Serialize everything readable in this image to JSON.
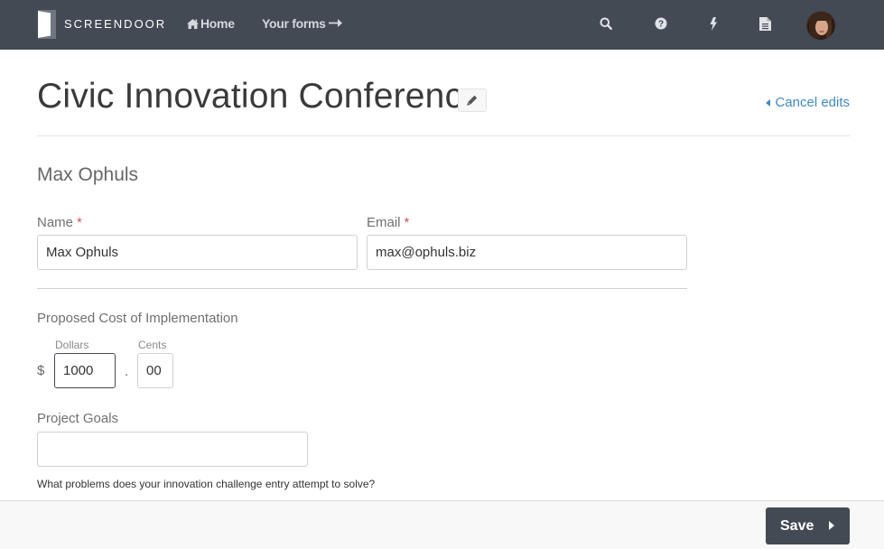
{
  "topbar": {
    "brand": "SCREENDOOR",
    "home_label": "Home",
    "forms_label": "Your forms",
    "icons": [
      "search-icon",
      "help-icon",
      "bolt-icon",
      "document-icon"
    ],
    "avatar_alt": "User avatar"
  },
  "header": {
    "title": "Civic Innovation Conference",
    "cancel_label": "Cancel edits"
  },
  "form": {
    "respondent_name": "Max Ophuls",
    "name": {
      "label": "Name",
      "required": "*",
      "value": "Max Ophuls"
    },
    "email": {
      "label": "Email",
      "required": "*",
      "value": "max@ophuls.biz"
    },
    "cost": {
      "label": "Proposed Cost of Implementation",
      "currency_symbol": "$",
      "dollars_label": "Dollars",
      "dollars_value": "1000",
      "separator": ".",
      "cents_label": "Cents",
      "cents_value": "00"
    },
    "goals": {
      "label": "Project Goals",
      "value": "",
      "help": "What problems does your innovation challenge entry attempt to solve?"
    }
  },
  "footer": {
    "save_label": "Save"
  },
  "colors": {
    "topbar": "#434a54",
    "link": "#3f88c8",
    "required": "#d9534f"
  }
}
